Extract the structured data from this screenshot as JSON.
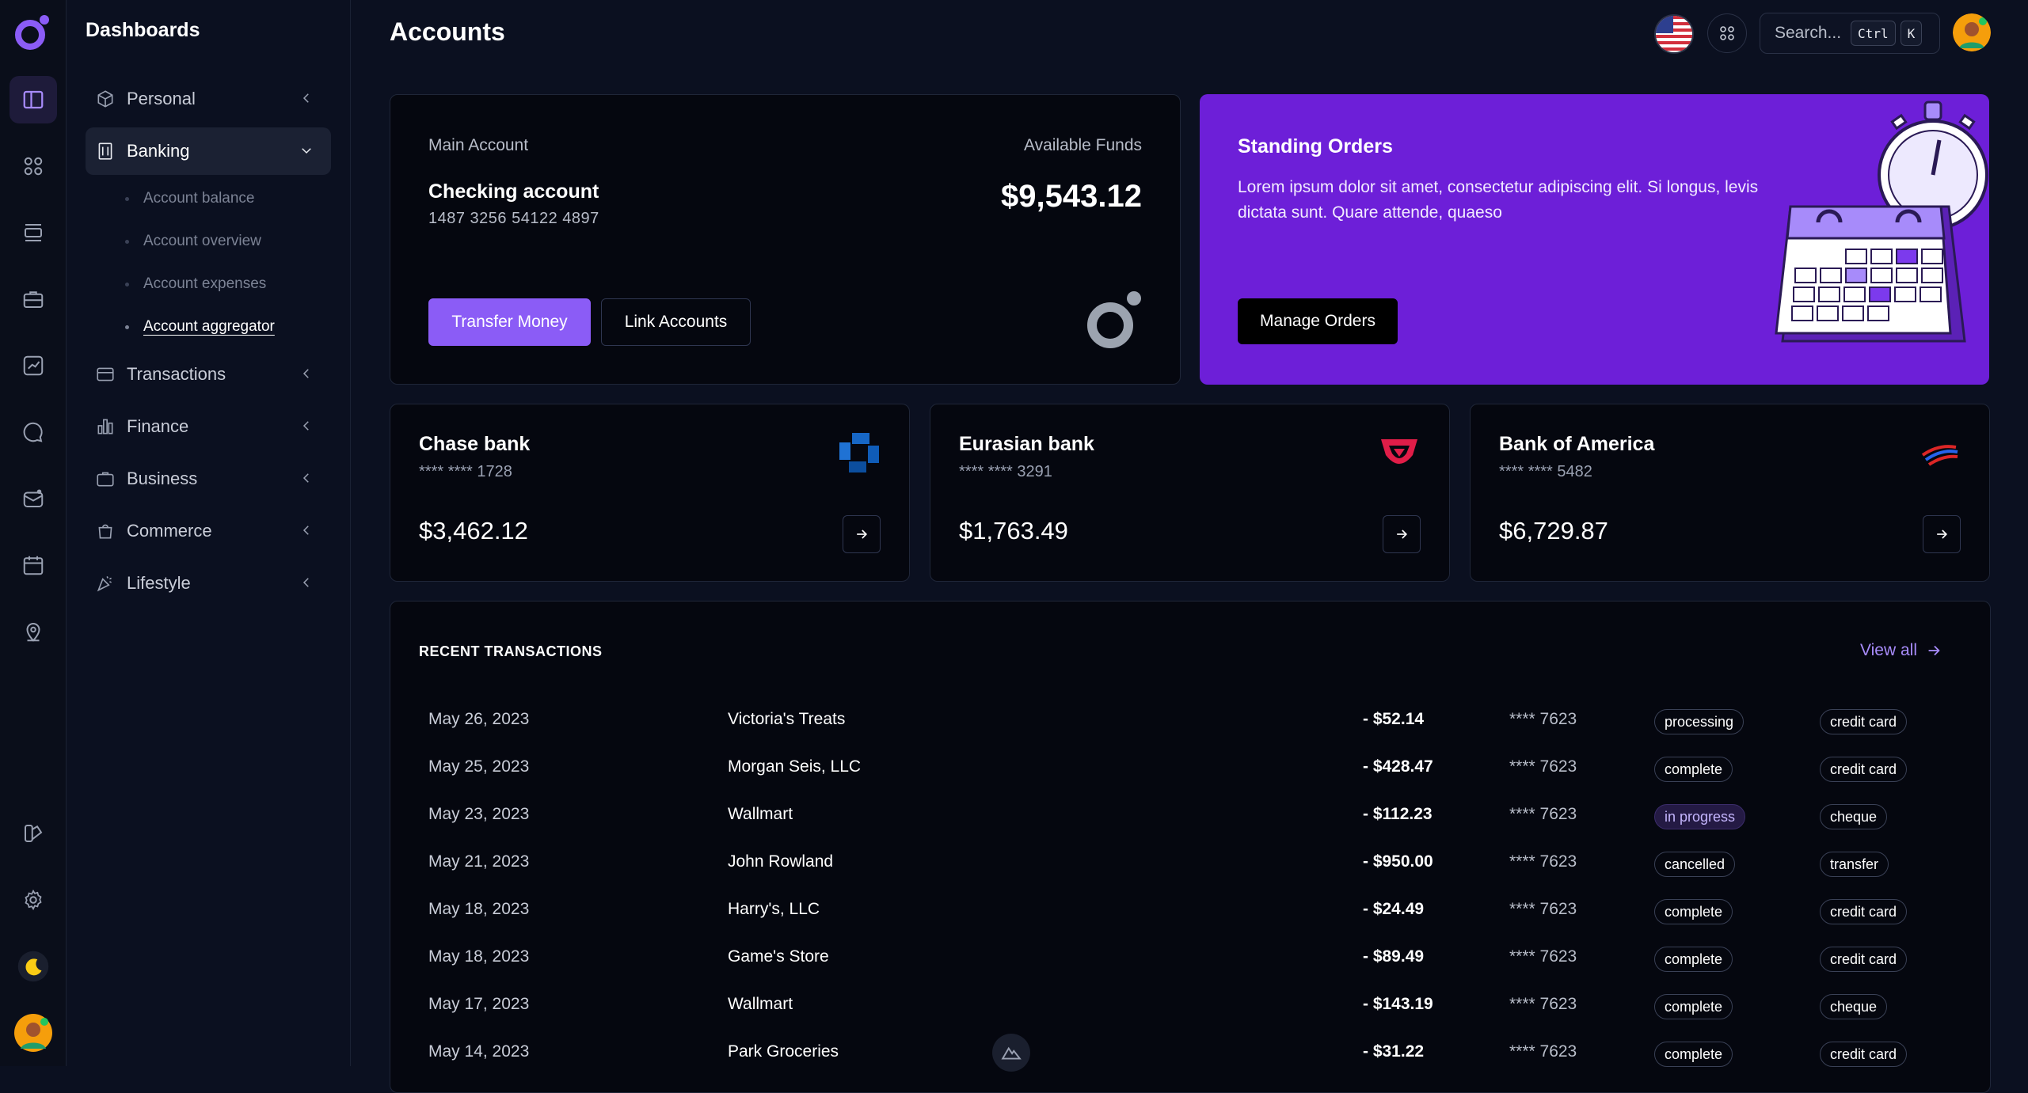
{
  "sidebar": {
    "title": "Dashboards",
    "nav": [
      {
        "label": "Personal"
      },
      {
        "label": "Banking"
      },
      {
        "label": "Transactions"
      },
      {
        "label": "Finance"
      },
      {
        "label": "Business"
      },
      {
        "label": "Commerce"
      },
      {
        "label": "Lifestyle"
      }
    ],
    "banking_sub": [
      {
        "label": "Account balance"
      },
      {
        "label": "Account overview"
      },
      {
        "label": "Account expenses"
      },
      {
        "label": "Account aggregator"
      }
    ]
  },
  "header": {
    "title": "Accounts",
    "search_placeholder": "Search...",
    "kbd_ctrl": "Ctrl",
    "kbd_k": "K"
  },
  "main_account": {
    "label": "Main Account",
    "name": "Checking account",
    "number": "1487 3256 54122 4897",
    "funds_label": "Available Funds",
    "funds": "$9,543.12",
    "transfer_label": "Transfer Money",
    "link_label": "Link Accounts"
  },
  "standing_orders": {
    "title": "Standing Orders",
    "text": "Lorem ipsum dolor sit amet, consectetur adipiscing elit. Si longus, levis dictata sunt. Quare attende, quaeso",
    "button": "Manage Orders"
  },
  "banks": [
    {
      "name": "Chase bank",
      "number": "**** **** 1728",
      "balance": "$3,462.12",
      "logo": "chase-logo"
    },
    {
      "name": "Eurasian bank",
      "number": "**** **** 3291",
      "balance": "$1,763.49",
      "logo": "eurasian-logo"
    },
    {
      "name": "Bank of America",
      "number": "**** **** 5482",
      "balance": "$6,729.87",
      "logo": "boa-logo"
    }
  ],
  "transactions": {
    "title": "RECENT TRANSACTIONS",
    "view_all": "View all",
    "rows": [
      {
        "date": "May 26, 2023",
        "merchant": "Victoria's Treats",
        "amount": "- $52.14",
        "card": "**** 7623",
        "status": "processing",
        "method": "credit card"
      },
      {
        "date": "May 25, 2023",
        "merchant": "Morgan Seis, LLC",
        "amount": "- $428.47",
        "card": "**** 7623",
        "status": "complete",
        "method": "credit card"
      },
      {
        "date": "May 23, 2023",
        "merchant": "Wallmart",
        "amount": "- $112.23",
        "card": "**** 7623",
        "status": "in progress",
        "method": "cheque"
      },
      {
        "date": "May 21, 2023",
        "merchant": "John Rowland",
        "amount": "- $950.00",
        "card": "**** 7623",
        "status": "cancelled",
        "method": "transfer"
      },
      {
        "date": "May 18, 2023",
        "merchant": "Harry's, LLC",
        "amount": "- $24.49",
        "card": "**** 7623",
        "status": "complete",
        "method": "credit card"
      },
      {
        "date": "May 18, 2023",
        "merchant": "Game's Store",
        "amount": "- $89.49",
        "card": "**** 7623",
        "status": "complete",
        "method": "credit card"
      },
      {
        "date": "May 17, 2023",
        "merchant": "Wallmart",
        "amount": "- $143.19",
        "card": "**** 7623",
        "status": "complete",
        "method": "cheque"
      },
      {
        "date": "May 14, 2023",
        "merchant": "Park Groceries",
        "amount": "- $31.22",
        "card": "**** 7623",
        "status": "complete",
        "method": "credit card"
      }
    ]
  },
  "colors": {
    "accent": "#8b5cf6",
    "promo": "#6d1fd8",
    "background": "#0b1020"
  }
}
